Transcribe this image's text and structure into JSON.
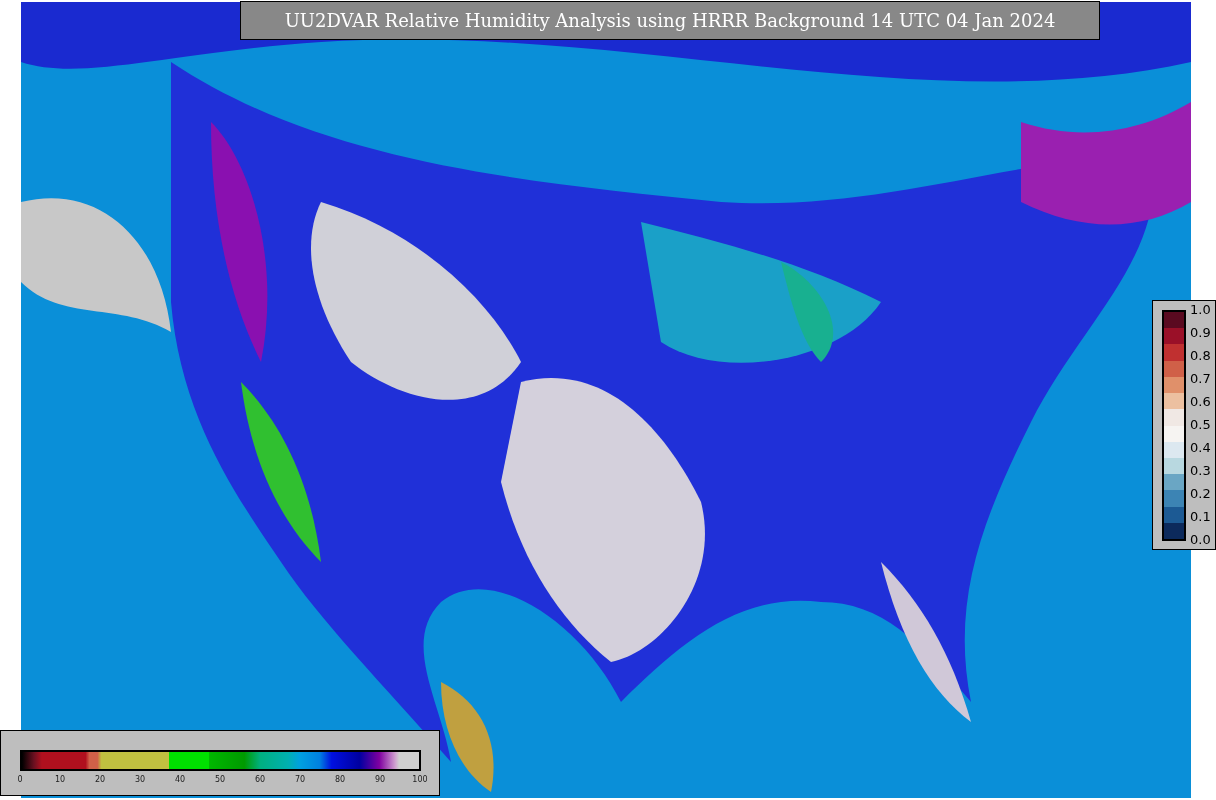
{
  "title": "UU2DVAR Relative Humidity Analysis using HRRR Background 14 UTC 04 Jan 2024",
  "colorbar_right": {
    "ticks": [
      "1.0",
      "0.9",
      "0.8",
      "0.7",
      "0.6",
      "0.5",
      "0.4",
      "0.3",
      "0.2",
      "0.1",
      "0.0"
    ]
  },
  "colorbar_bottom": {
    "ticks": [
      "0",
      "10",
      "20",
      "30",
      "40",
      "50",
      "60",
      "70",
      "80",
      "90",
      "100"
    ]
  }
}
